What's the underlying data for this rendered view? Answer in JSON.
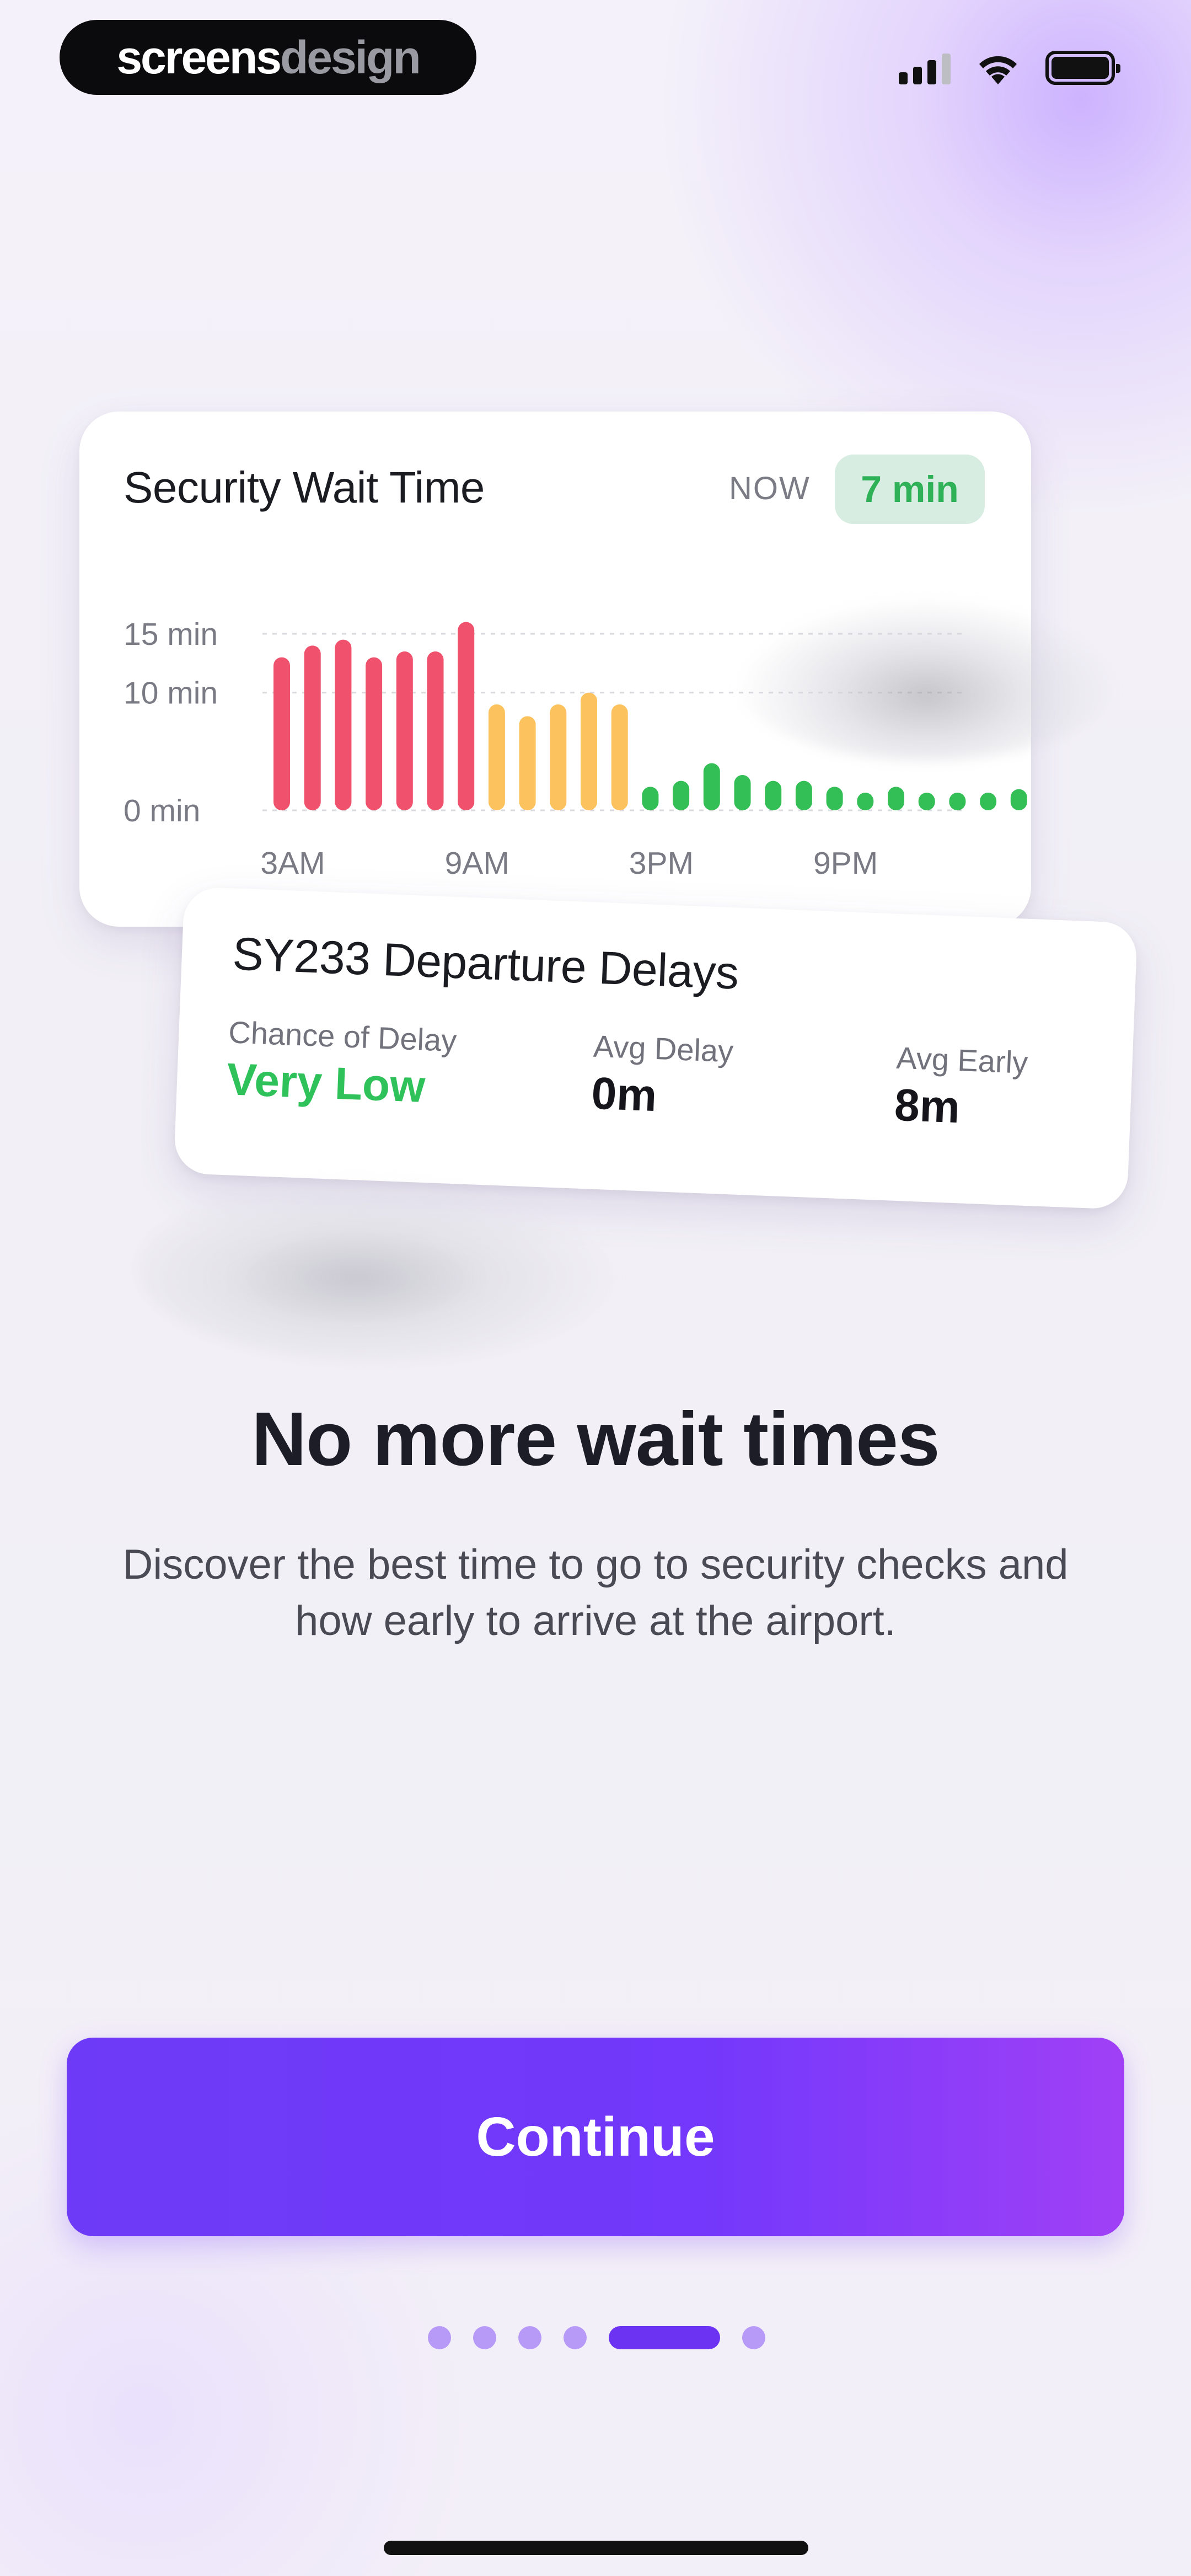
{
  "brand": {
    "part1": "screens",
    "part2": "design"
  },
  "status_bar": {
    "icons": [
      "cellular-signal-icon",
      "wifi-icon",
      "battery-icon"
    ]
  },
  "wait_card": {
    "title": "Security Wait Time",
    "now_label": "NOW",
    "now_value": "7 min"
  },
  "chart_data": {
    "type": "bar",
    "title": "Security Wait Time",
    "y_ticks": [
      "15 min",
      "10 min",
      "0 min"
    ],
    "x_ticks": [
      "3AM",
      "9AM",
      "3PM",
      "9PM"
    ],
    "ylim": [
      0,
      15
    ],
    "grid": true,
    "unit": "min",
    "values": [
      13,
      14,
      14.5,
      13,
      13.5,
      13.5,
      16,
      9,
      8,
      9,
      10,
      9,
      2,
      2.5,
      4,
      3,
      2.5,
      2.5,
      2,
      1.5,
      2,
      1.5,
      1.5,
      1.5,
      1.8
    ],
    "colors": {
      "high": "#f0516d",
      "medium": "#fcc25e",
      "low": "#33bf55"
    },
    "levels": [
      "high",
      "high",
      "high",
      "high",
      "high",
      "high",
      "high",
      "medium",
      "medium",
      "medium",
      "medium",
      "medium",
      "low",
      "low",
      "low",
      "low",
      "low",
      "low",
      "low",
      "low",
      "low",
      "low",
      "low",
      "low",
      "low"
    ]
  },
  "delay_card": {
    "title": "SY233 Departure Delays",
    "stats": [
      {
        "label": "Chance of Delay",
        "value": "Very Low"
      },
      {
        "label": "Avg Delay",
        "value": "0m"
      },
      {
        "label": "Avg Early",
        "value": "8m"
      }
    ]
  },
  "headline": "No more wait times",
  "subtext_line1": "Discover the best time to go to security checks and",
  "subtext_line2": "how early to arrive at the airport.",
  "continue_label": "Continue",
  "pager": {
    "count": 6,
    "active_index": 4
  },
  "accent_color": "#7338fb"
}
